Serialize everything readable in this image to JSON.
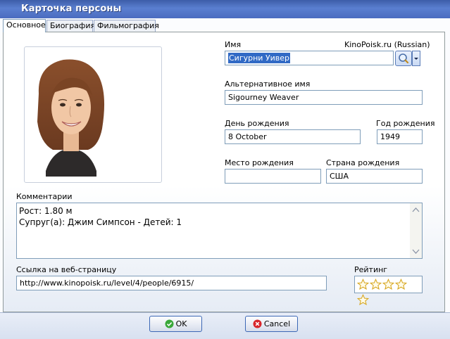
{
  "window": {
    "title": "Карточка персоны"
  },
  "tabs": [
    {
      "label": "Основное",
      "active": true
    },
    {
      "label": "Биография",
      "active": false
    },
    {
      "label": "Фильмография",
      "active": false
    }
  ],
  "form": {
    "name_label": "Имя",
    "source_label": "KinoPoisk.ru (Russian)",
    "name_value": "Сигурни Уивер",
    "alt_name_label": "Альтернативное имя",
    "alt_name_value": "Sigourney Weaver",
    "birthday_label": "День рождения",
    "birthday_value": "8 October",
    "birth_year_label": "Год рождения",
    "birth_year_value": "1949",
    "birthplace_label": "Место рождения",
    "birthplace_value": "",
    "country_label": "Страна рождения",
    "country_value": "США",
    "comments_label": "Комментарии",
    "comments_lines": [
      "Рост: 1.80 м",
      "Супруг(а): Джим Симпсон - Детей: 1"
    ],
    "url_label": "Ссылка на веб-страницу",
    "url_value": "http://www.kinopoisk.ru/level/4/people/6915/",
    "rating_label": "Рейтинг",
    "rating_value": 0,
    "rating_max": 5
  },
  "buttons": {
    "ok_label": "OK",
    "cancel_label": "Cancel"
  },
  "colors": {
    "title_bar": "#4b6cc0",
    "selection": "#316ac5",
    "border": "#7f9db9",
    "star": "#f0c020"
  },
  "icons": {
    "search": "magnifier-icon",
    "ok": "check-icon",
    "cancel": "x-circle-icon",
    "star": "star-icon"
  }
}
